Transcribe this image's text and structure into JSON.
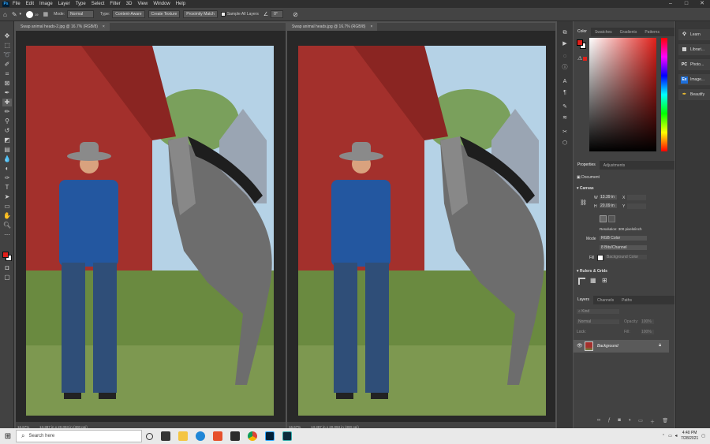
{
  "menu": {
    "app_badge": "Ps",
    "items": [
      "File",
      "Edit",
      "Image",
      "Layer",
      "Type",
      "Select",
      "Filter",
      "3D",
      "View",
      "Window",
      "Help"
    ]
  },
  "options": {
    "mode_label": "Mode:",
    "mode_value": "Normal",
    "type_label": "Type:",
    "content_aware": "Content-Aware",
    "create_texture": "Create Texture",
    "proximity_match": "Proximity Match",
    "sample_all_layers": "Sample All Layers",
    "angle_value": "0°",
    "brush_size": "19"
  },
  "docs": [
    {
      "tab": "Swap animal heads-2.jpg @ 16.7% (RGB/8)",
      "zoom": "16.67%",
      "info": "13.387 in x 20.093 in (300 ppi)"
    },
    {
      "tab": "Swap animal heads.jpg @ 16.7% (RGB/8)",
      "zoom": "16.67%",
      "info": "13.387 in x 20.093 in (300 ppi)"
    }
  ],
  "color_panel": {
    "tabs": [
      "Color",
      "Swatches",
      "Gradients",
      "Patterns"
    ]
  },
  "properties": {
    "tabs": [
      "Properties",
      "Adjustments"
    ],
    "document": "Document",
    "canvas_title": "Canvas",
    "w_label": "W",
    "w_value": "13.39 in",
    "h_label": "H",
    "h_value": "20.09 in",
    "x_label": "X",
    "y_label": "Y",
    "resolution": "Resolution: 300 pixels/inch",
    "mode_label": "Mode",
    "mode_value": "RGB Color",
    "depth_value": "8 Bits/Channel",
    "fill_label": "Fill",
    "fill_value": "Background Color",
    "rulers_title": "Rulers & Grids"
  },
  "layers": {
    "tabs": [
      "Layers",
      "Channels",
      "Paths"
    ],
    "kind": "Kind",
    "blend": "Normal",
    "opacity_label": "Opacity:",
    "opacity_value": "100%",
    "lock_label": "Lock:",
    "fill_label": "Fill:",
    "fill_value": "100%",
    "layer_name": "Background"
  },
  "libraries": [
    {
      "label": "Learn",
      "icon": "bulb-icon"
    },
    {
      "label": "Librari...",
      "icon": "libraries-icon"
    },
    {
      "label": "Photo...",
      "icon": "pc-icon"
    },
    {
      "label": "Image...",
      "icon": "ex-icon"
    },
    {
      "label": "Beautify",
      "icon": "beautify-icon"
    }
  ],
  "taskbar": {
    "search_placeholder": "Search here",
    "time": "4:40 PM",
    "date": "7/28/2021"
  },
  "colors": {
    "foreground": "#e0201a",
    "background": "#ffffff",
    "barn_red": "#a3302c",
    "shirt_blue": "#2357a0"
  }
}
